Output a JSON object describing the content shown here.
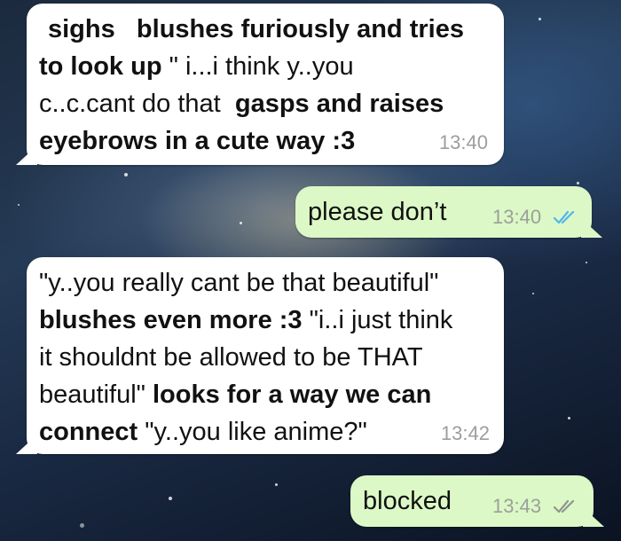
{
  "theme": {
    "incoming_bubble": "#ffffff",
    "outgoing_bubble": "#dcf8c6",
    "read_tick_color": "#4fb6ec",
    "time_color": "#9aa09a"
  },
  "messages": [
    {
      "direction": "incoming",
      "lines": {
        "l1": {
          "a": "sighs",
          "b": "blushes furiously and tries"
        },
        "l2": {
          "a": "to look up",
          "b": " \" i...i think y..you"
        },
        "l3": {
          "a": "c..c.cant do that",
          "b": "gasps and raises"
        },
        "l4": {
          "a": "eyebrows in a cute way :3"
        }
      },
      "time": "13:40"
    },
    {
      "direction": "outgoing",
      "text": "please don’t",
      "time": "13:40",
      "status_icon": "double-check-read-icon"
    },
    {
      "direction": "incoming",
      "lines": {
        "l1": {
          "a": "\"y..you really cant be that beautiful\""
        },
        "l2": {
          "a": "blushes even more :3",
          "b": " \"i..i just think"
        },
        "l3": {
          "a": "it shouldnt be allowed to be THAT"
        },
        "l4": {
          "a": "beautiful\"",
          "b": "looks for a way we can"
        },
        "l5": {
          "a": "connect",
          "b": " \"y..you like anime?\""
        }
      },
      "time": "13:42"
    },
    {
      "direction": "outgoing",
      "text": "blocked",
      "time": "13:43",
      "status_icon": "double-check-delivered-icon"
    }
  ]
}
